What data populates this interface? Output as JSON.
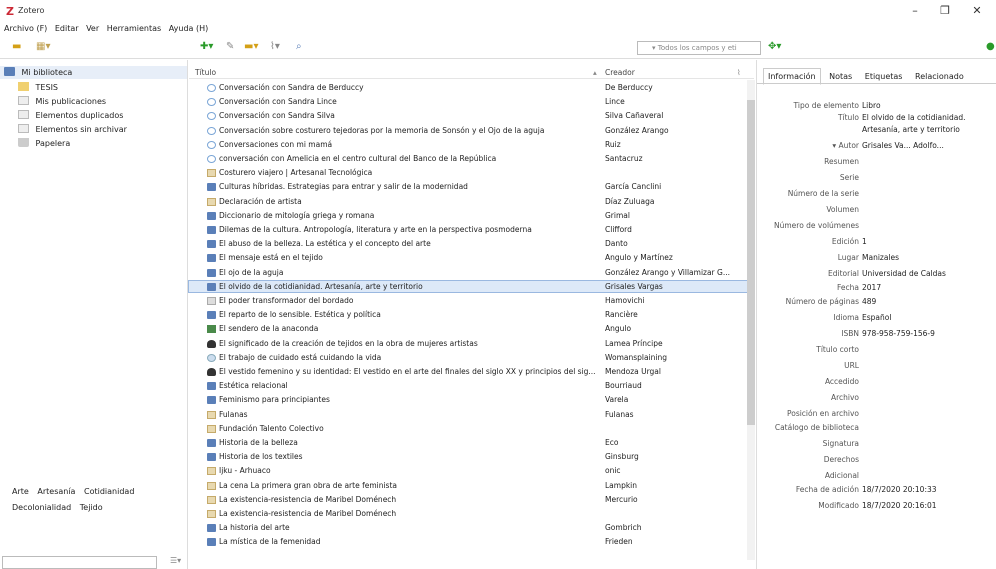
{
  "window": {
    "title": "Zotero",
    "logo": "Z",
    "minimize": "–",
    "maximize": "❐",
    "close": "✕"
  },
  "menu": [
    "Archivo (F)",
    "Editar",
    "Ver",
    "Herramientas",
    "Ayuda (H)"
  ],
  "search": {
    "placeholder": "▾ Todos los campos y eti"
  },
  "library": {
    "root": "Mi biblioteca",
    "items": [
      {
        "label": "TESIS",
        "icon": "folder-icon"
      },
      {
        "label": "Mis publicaciones",
        "icon": "publications-icon"
      },
      {
        "label": "Elementos duplicados",
        "icon": "duplicates-icon"
      },
      {
        "label": "Elementos sin archivar",
        "icon": "unfiled-icon"
      },
      {
        "label": "Papelera",
        "icon": "trash-icon"
      }
    ]
  },
  "tags": [
    "Arte",
    "Artesanía",
    "Cotidianidad",
    "Decolonialidad",
    "Tejido"
  ],
  "columns": {
    "title": "Título",
    "creator": "Creador"
  },
  "rows": [
    {
      "title": "Conversación con Sandra de Berduccy",
      "creator": "De Berduccy",
      "icon": "conv"
    },
    {
      "title": "Conversación con Sandra Lince",
      "creator": "Lince",
      "icon": "conv"
    },
    {
      "title": "Conversación con Sandra Silva",
      "creator": "Silva Cañaveral",
      "icon": "conv"
    },
    {
      "title": "Conversación sobre costurero tejedoras por la memoria de Sonsón y el Ojo de la aguja",
      "creator": "González Arango",
      "icon": "conv"
    },
    {
      "title": "Conversaciones con mi mamá",
      "creator": "Ruiz",
      "icon": "conv"
    },
    {
      "title": "conversación con Amelicia en el centro cultural del Banco de la República",
      "creator": "Santacruz",
      "icon": "conv"
    },
    {
      "title": "Costurero viajero | Artesanal Tecnológica",
      "creator": "",
      "icon": "doc"
    },
    {
      "title": "Culturas híbridas. Estrategias para entrar y salir de la modernidad",
      "creator": "García Canclini",
      "icon": "book"
    },
    {
      "title": "Declaración de artista",
      "creator": "Díaz Zuluaga",
      "icon": "doc"
    },
    {
      "title": "Diccionario de mitología griega y romana",
      "creator": "Grimal",
      "icon": "book"
    },
    {
      "title": "Dilemas de la cultura. Antropología, literatura y arte en la perspectiva posmoderna",
      "creator": "Clifford",
      "icon": "book"
    },
    {
      "title": "El abuso de la belleza. La estética y el concepto del arte",
      "creator": "Danto",
      "icon": "book"
    },
    {
      "title": "El mensaje está en el tejido",
      "creator": "Angulo y Martínez",
      "icon": "book"
    },
    {
      "title": "El ojo de la aguja",
      "creator": "González Arango y Villamizar G...",
      "icon": "book"
    },
    {
      "title": "El olvido de la cotidianidad. Artesanía, arte y territorio",
      "creator": "Grisales Vargas",
      "icon": "book",
      "selected": true
    },
    {
      "title": "El poder transformador del bordado",
      "creator": "Hamovichi",
      "icon": "art"
    },
    {
      "title": "El reparto de lo sensible. Estética y política",
      "creator": "Rancière",
      "icon": "book"
    },
    {
      "title": "El sendero de la anaconda",
      "creator": "Angulo",
      "icon": "map"
    },
    {
      "title": "El significado de la creación de tejidos en la obra de mujeres artistas",
      "creator": "Lamea Príncipe",
      "icon": "cap"
    },
    {
      "title": "El trabajo de cuidado está cuidando la vida",
      "creator": "Womansplaining",
      "icon": "web"
    },
    {
      "title": "El vestido femenino y su identidad: El vestido en el arte del finales del siglo XX y principios del sig...",
      "creator": "Mendoza Urgal",
      "icon": "cap"
    },
    {
      "title": "Estética relacional",
      "creator": "Bourriaud",
      "icon": "book"
    },
    {
      "title": "Feminismo para principiantes",
      "creator": "Varela",
      "icon": "book"
    },
    {
      "title": "Fulanas",
      "creator": "Fulanas",
      "icon": "doc"
    },
    {
      "title": "Fundación Talento Colectivo",
      "creator": "",
      "icon": "doc"
    },
    {
      "title": "Historia de la belleza",
      "creator": "Eco",
      "icon": "book"
    },
    {
      "title": "Historia de los textiles",
      "creator": "Ginsburg",
      "icon": "book"
    },
    {
      "title": "Ijku - Arhuaco",
      "creator": "onic",
      "icon": "doc"
    },
    {
      "title": "La cena La primera gran obra de arte feminista",
      "creator": "Lampkin",
      "icon": "doc"
    },
    {
      "title": "La existencia-resistencia de Maribel Doménech",
      "creator": "Mercurio",
      "icon": "doc"
    },
    {
      "title": "La existencia-resistencia de Maribel Doménech",
      "creator": "",
      "icon": "doc"
    },
    {
      "title": "La historia del arte",
      "creator": "Gombrich",
      "icon": "book"
    },
    {
      "title": "La mística de la femenidad",
      "creator": "Frieden",
      "icon": "book"
    }
  ],
  "tabs": [
    "Información",
    "Notas",
    "Etiquetas",
    "Relacionado"
  ],
  "info": [
    {
      "label": "Tipo de elemento",
      "value": "Libro"
    },
    {
      "label": "Título",
      "value": "El olvido de la cotidianidad."
    },
    {
      "label": "",
      "value": "Artesanía, arte y territorio"
    },
    {
      "label": "▾ Autor",
      "value": "Grisales Va...  Adolfo..."
    },
    {
      "label": "Resumen",
      "value": ""
    },
    {
      "label": "Serie",
      "value": ""
    },
    {
      "label": "Número de la serie",
      "value": ""
    },
    {
      "label": "Volumen",
      "value": ""
    },
    {
      "label": "Número de volúmenes",
      "value": ""
    },
    {
      "label": "Edición",
      "value": "1"
    },
    {
      "label": "Lugar",
      "value": "Manizales"
    },
    {
      "label": "Editorial",
      "value": "Universidad de Caldas"
    },
    {
      "label": "Fecha",
      "value": "2017"
    },
    {
      "label": "Número de páginas",
      "value": "489"
    },
    {
      "label": "Idioma",
      "value": "Español"
    },
    {
      "label": "ISBN",
      "value": "978-958-759-156-9"
    },
    {
      "label": "Título corto",
      "value": ""
    },
    {
      "label": "URL",
      "value": ""
    },
    {
      "label": "Accedido",
      "value": ""
    },
    {
      "label": "Archivo",
      "value": ""
    },
    {
      "label": "Posición en archivo",
      "value": ""
    },
    {
      "label": "Catálogo de biblioteca",
      "value": ""
    },
    {
      "label": "Signatura",
      "value": ""
    },
    {
      "label": "Derechos",
      "value": ""
    },
    {
      "label": "Adicional",
      "value": ""
    },
    {
      "label": "Fecha de adición",
      "value": "18/7/2020 20:10:33"
    },
    {
      "label": "Modificado",
      "value": "18/7/2020 20:16:01"
    }
  ]
}
